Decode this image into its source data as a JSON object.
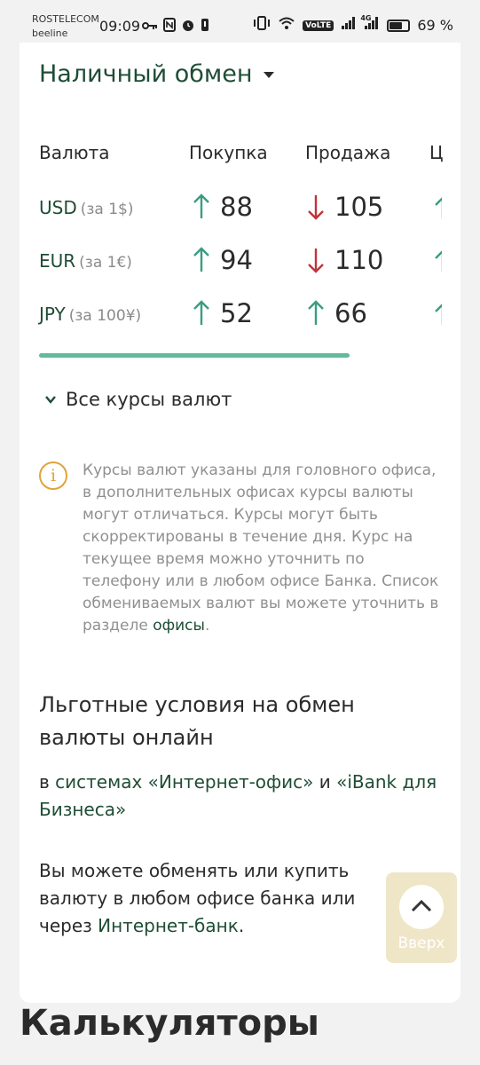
{
  "status_bar": {
    "carrier_1": "ROSTELECOM",
    "carrier_2": "beeline",
    "time": "09:09",
    "battery_percent": 69,
    "battery_text": "69 %",
    "volte_text": "VoLTE",
    "network_text": "4G"
  },
  "exchange": {
    "type_label": "Наличный обмен",
    "headers": {
      "currency": "Валюта",
      "buy": "Покупка",
      "sell": "Продажа",
      "clipped": "Ц"
    },
    "rows": [
      {
        "code": "USD",
        "unit": "(за 1$)",
        "buy": "88",
        "buy_dir": "up",
        "sell": "105",
        "sell_dir": "down"
      },
      {
        "code": "EUR",
        "unit": "(за 1€)",
        "buy": "94",
        "buy_dir": "up",
        "sell": "110",
        "sell_dir": "down"
      },
      {
        "code": "JPY",
        "unit": "(за 100¥)",
        "buy": "52",
        "buy_dir": "up",
        "sell": "66",
        "sell_dir": "up"
      }
    ],
    "all_rates_label": "Все курсы валют"
  },
  "info": {
    "text": "Курсы валют указаны для головного офиса, в дополнительных офисах курсы валюты могут отличаться. Курсы могут быть скорректированы в течение дня. Курс на текущее время можно уточнить по телефону или в любом офисе Банка. Список обмениваемых валют вы можете уточнить в разделе ",
    "link": "офисы",
    "suffix": "."
  },
  "benefit": {
    "heading": "Льготные условия на обмен валюты онлайн",
    "systems_prefix": "в ",
    "systems_link_1": "системах «Интернет-офис»",
    "systems_mid": " и ",
    "systems_link_2": "«iBank для Бизнеса»",
    "offices_text": "Вы можете обменять или купить валюту в любом офисе банка или через ",
    "offices_link": "Интернет-банк",
    "offices_suffix": "."
  },
  "up_button": {
    "label": "Вверх"
  },
  "calculators": {
    "title": "Калькуляторы"
  },
  "colors": {
    "brand_green": "#1f4d35",
    "up_arrow": "#3a9d80",
    "down_arrow": "#c0343a",
    "scroll_bar": "#62ba9b",
    "info_icon": "#e0a33a"
  }
}
